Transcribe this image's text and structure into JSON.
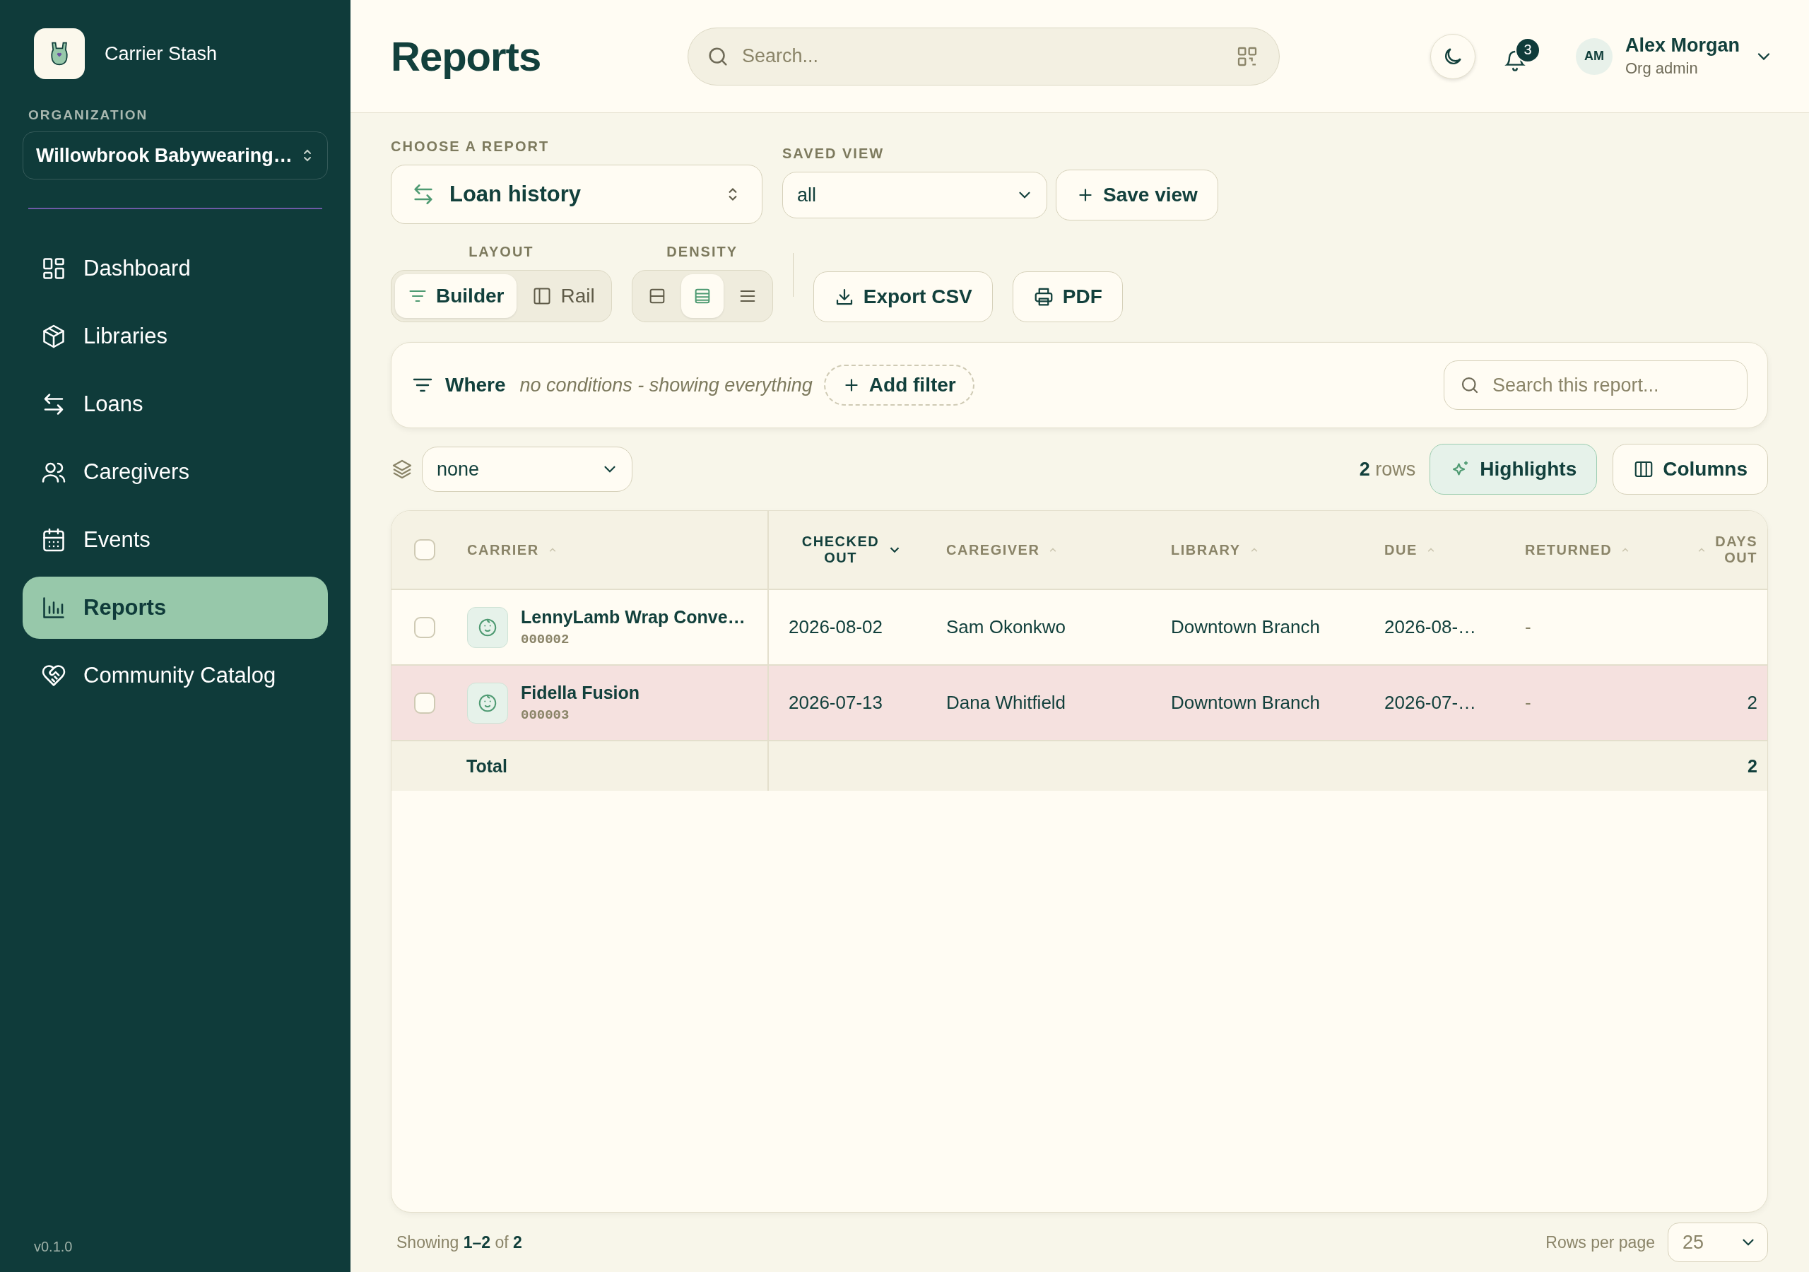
{
  "app": {
    "name": "Carrier Stash",
    "version": "v0.1.0"
  },
  "organization": {
    "label": "ORGANIZATION",
    "value": "Willowbrook Babywearing…"
  },
  "nav": [
    {
      "label": "Dashboard",
      "kind": "grid",
      "selected": false
    },
    {
      "label": "Libraries",
      "kind": "cube",
      "selected": false
    },
    {
      "label": "Loans",
      "kind": "swap",
      "selected": false
    },
    {
      "label": "Caregivers",
      "kind": "people",
      "selected": false
    },
    {
      "label": "Events",
      "kind": "calendar",
      "selected": false
    },
    {
      "label": "Reports",
      "kind": "chart",
      "selected": true
    },
    {
      "label": "Community Catalog",
      "kind": "heart",
      "selected": false
    }
  ],
  "header": {
    "title": "Reports",
    "search_placeholder": "Search...",
    "notifications": "3",
    "user": {
      "initials": "AM",
      "name": "Alex Morgan",
      "role": "Org admin"
    }
  },
  "report": {
    "label": "CHOOSE A REPORT",
    "value": "Loan history"
  },
  "saved_view": {
    "label": "SAVED VIEW",
    "value": "all",
    "save_button": "Save view"
  },
  "layout": {
    "label": "LAYOUT",
    "options": [
      {
        "label": "Builder",
        "kind": "builder",
        "selected": true
      },
      {
        "label": "Rail",
        "kind": "rail",
        "selected": false
      }
    ]
  },
  "density": {
    "label": "DENSITY",
    "options": [
      {
        "kind": "compact",
        "selected": false
      },
      {
        "kind": "comfortable",
        "selected": true
      },
      {
        "kind": "list",
        "selected": false
      }
    ]
  },
  "actions": [
    {
      "label": "Export CSV",
      "kind": "export"
    },
    {
      "label": "PDF",
      "kind": "print"
    }
  ],
  "filter": {
    "label": "Where",
    "hint": "no conditions - showing everything",
    "add_button": "Add filter",
    "search_placeholder": "Search this report..."
  },
  "group_by": {
    "value": "none"
  },
  "row_count": {
    "count": "2",
    "unit": "rows"
  },
  "highlights": {
    "label": "Highlights",
    "on": true
  },
  "columns_button": "Columns",
  "table": {
    "all_checked": false,
    "columns": [
      {
        "label": "CARRIER",
        "sorted": false
      },
      {
        "label": "CHECKED OUT",
        "sorted": true
      },
      {
        "label": "CAREGIVER",
        "sorted": false
      },
      {
        "label": "LIBRARY",
        "sorted": false
      },
      {
        "label": "DUE",
        "sorted": false
      },
      {
        "label": "RETURNED",
        "sorted": false
      },
      {
        "label": "DAYS OUT",
        "sorted": false
      }
    ],
    "rows": [
      {
        "checked": false,
        "highlighted": false,
        "carrier": "LennyLamb Wrap Conve…",
        "id": "000002",
        "checked_out": "2026-08-02",
        "caregiver": "Sam Okonkwo",
        "library": "Downtown Branch",
        "due": "2026-08-…",
        "returned": "-"
      },
      {
        "checked": false,
        "highlighted": true,
        "carrier": "Fidella Fusion",
        "id": "000003",
        "checked_out": "2026-07-13",
        "caregiver": "Dana Whitfield",
        "library": "Downtown Branch",
        "due": "2026-07-…",
        "returned": "-",
        "days_out": "2"
      }
    ],
    "total": {
      "label": "Total",
      "days_out": "2"
    }
  },
  "footer": {
    "showing": "Showing **1–2** of **2**",
    "rows_per_page_label": "Rows per page",
    "rows_per_page": "25"
  }
}
